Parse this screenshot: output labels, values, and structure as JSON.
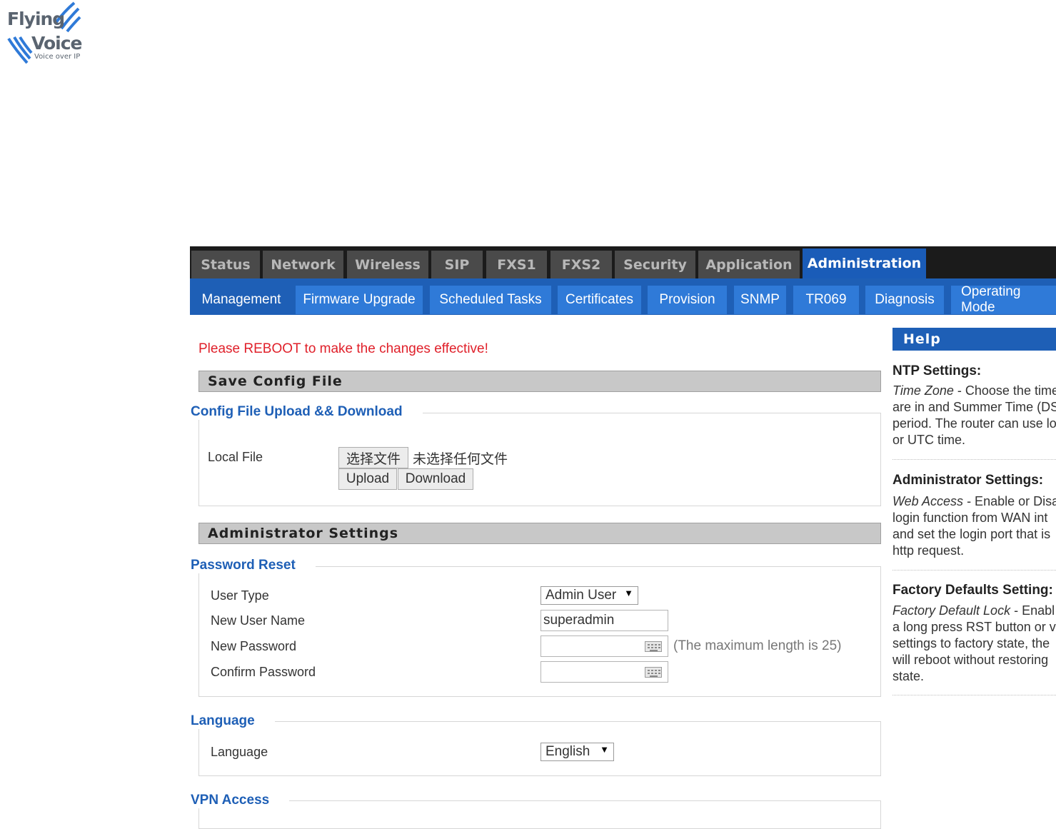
{
  "logo": {
    "word1": "Flying",
    "word2": "Voice",
    "tagline": "Voice over IP"
  },
  "top_tabs": [
    "Status",
    "Network",
    "Wireless",
    "SIP",
    "FXS1",
    "FXS2",
    "Security",
    "Application",
    "Administration"
  ],
  "active_top_tab": "Administration",
  "sub_tabs": [
    "Management",
    "Firmware Upgrade",
    "Scheduled Tasks",
    "Certificates",
    "Provision",
    "SNMP",
    "TR069",
    "Diagnosis",
    "Operating Mode"
  ],
  "active_sub_tab": "Management",
  "notice": "Please REBOOT to make the changes effective!",
  "save_config": {
    "title": "Save Config File",
    "legend": "Config File Upload && Download",
    "local_file_label": "Local File",
    "choose_file_button": "选择文件",
    "no_file_text": "未选择任何文件",
    "upload_button": "Upload",
    "download_button": "Download"
  },
  "admin_settings": {
    "title": "Administrator Settings",
    "password_reset_legend": "Password Reset",
    "user_type_label": "User Type",
    "user_type_value": "Admin User",
    "new_user_name_label": "New User Name",
    "new_user_name_value": "superadmin",
    "new_password_label": "New Password",
    "max_length_hint": "(The maximum length is 25)",
    "confirm_password_label": "Confirm Password",
    "language_legend": "Language",
    "language_label": "Language",
    "language_value": "English",
    "vpn_legend": "VPN Access"
  },
  "help": {
    "header": "Help",
    "ntp_title": "NTP Settings:",
    "ntp_lines": [
      "- Choose the time",
      "are in and Summer Time (DS",
      "period. The router can use lo",
      "or UTC time."
    ],
    "ntp_term": "Time Zone",
    "admin_title": "Administrator Settings:",
    "admin_term": "Web Access",
    "admin_lines": [
      "- Enable or Disa",
      "login function from WAN int",
      "and set the login port that is",
      "http request."
    ],
    "factory_title": "Factory Defaults Setting:",
    "factory_term": "Factory Default Lock",
    "factory_lines": [
      "- Enabl",
      "a long press RST button or v",
      "settings to factory state, the",
      "will reboot without restoring",
      "state."
    ]
  }
}
